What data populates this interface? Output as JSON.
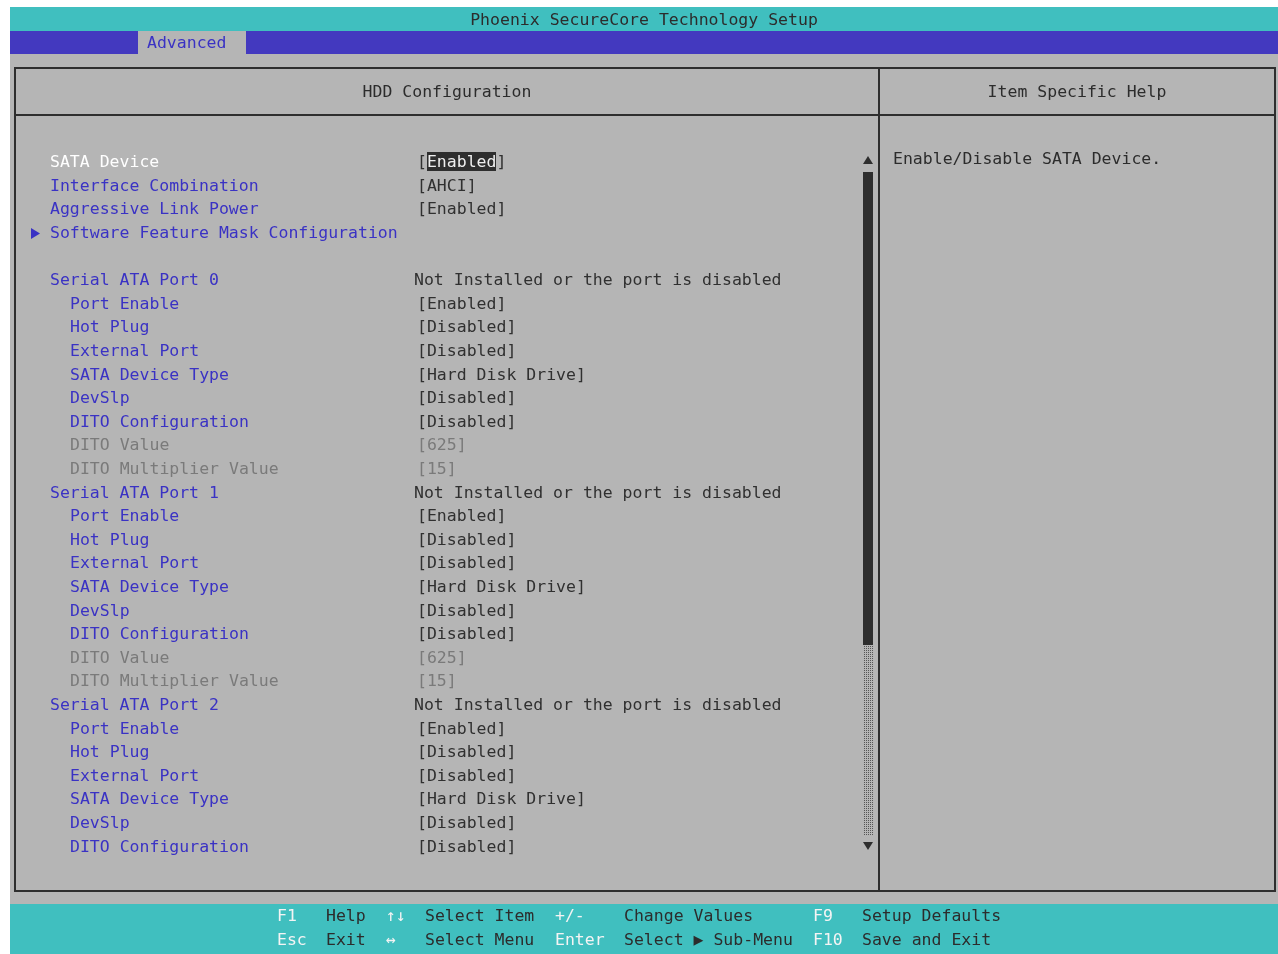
{
  "window": {
    "title": "Phoenix SecureCore Technology Setup"
  },
  "tabs": [
    {
      "label": "Advanced",
      "selected": true
    }
  ],
  "panel": {
    "title": "HDD Configuration"
  },
  "help": {
    "title": "Item Specific Help",
    "text": "Enable/Disable SATA Device."
  },
  "sections": [
    {
      "items": [
        {
          "label": "SATA Device",
          "value": "[Enabled]",
          "kind": "option",
          "selected": true,
          "disabled": false
        },
        {
          "label": "Interface Combination",
          "value": "[AHCI]",
          "kind": "option",
          "selected": false,
          "disabled": false
        },
        {
          "label": "Aggressive Link Power",
          "value": "[Enabled]",
          "kind": "option",
          "selected": false,
          "disabled": false
        },
        {
          "label": "Software Feature Mask Configuration",
          "kind": "submenu",
          "selected": false,
          "disabled": false
        }
      ]
    },
    {
      "items": [
        {
          "label": "Serial ATA Port 0",
          "value": "Not Installed or the port is disabled",
          "kind": "info",
          "selected": false,
          "disabled": false,
          "children": [
            {
              "label": "Port Enable",
              "value": "[Enabled]",
              "kind": "option",
              "selected": false,
              "disabled": false
            },
            {
              "label": "Hot Plug",
              "value": "[Disabled]",
              "kind": "option",
              "selected": false,
              "disabled": false
            },
            {
              "label": "External Port",
              "value": "[Disabled]",
              "kind": "option",
              "selected": false,
              "disabled": false
            },
            {
              "label": "SATA Device Type",
              "value": "[Hard Disk Drive]",
              "kind": "option",
              "selected": false,
              "disabled": false
            },
            {
              "label": "DevSlp",
              "value": "[Disabled]",
              "kind": "option",
              "selected": false,
              "disabled": false
            },
            {
              "label": "DITO Configuration",
              "value": "[Disabled]",
              "kind": "option",
              "selected": false,
              "disabled": false
            },
            {
              "label": "DITO Value",
              "value": "[625]",
              "kind": "option",
              "selected": false,
              "disabled": true
            },
            {
              "label": "DITO Multiplier Value",
              "value": "[15]",
              "kind": "option",
              "selected": false,
              "disabled": true
            }
          ]
        },
        {
          "label": "Serial ATA Port 1",
          "value": "Not Installed or the port is disabled",
          "kind": "info",
          "selected": false,
          "disabled": false,
          "children": [
            {
              "label": "Port Enable",
              "value": "[Enabled]",
              "kind": "option",
              "selected": false,
              "disabled": false
            },
            {
              "label": "Hot Plug",
              "value": "[Disabled]",
              "kind": "option",
              "selected": false,
              "disabled": false
            },
            {
              "label": "External Port",
              "value": "[Disabled]",
              "kind": "option",
              "selected": false,
              "disabled": false
            },
            {
              "label": "SATA Device Type",
              "value": "[Hard Disk Drive]",
              "kind": "option",
              "selected": false,
              "disabled": false
            },
            {
              "label": "DevSlp",
              "value": "[Disabled]",
              "kind": "option",
              "selected": false,
              "disabled": false
            },
            {
              "label": "DITO Configuration",
              "value": "[Disabled]",
              "kind": "option",
              "selected": false,
              "disabled": false
            },
            {
              "label": "DITO Value",
              "value": "[625]",
              "kind": "option",
              "selected": false,
              "disabled": true
            },
            {
              "label": "DITO Multiplier Value",
              "value": "[15]",
              "kind": "option",
              "selected": false,
              "disabled": true
            }
          ]
        },
        {
          "label": "Serial ATA Port 2",
          "value": "Not Installed or the port is disabled",
          "kind": "info",
          "selected": false,
          "disabled": false,
          "children": [
            {
              "label": "Port Enable",
              "value": "[Enabled]",
              "kind": "option",
              "selected": false,
              "disabled": false
            },
            {
              "label": "Hot Plug",
              "value": "[Disabled]",
              "kind": "option",
              "selected": false,
              "disabled": false
            },
            {
              "label": "External Port",
              "value": "[Disabled]",
              "kind": "option",
              "selected": false,
              "disabled": false
            },
            {
              "label": "SATA Device Type",
              "value": "[Hard Disk Drive]",
              "kind": "option",
              "selected": false,
              "disabled": false
            },
            {
              "label": "DevSlp",
              "value": "[Disabled]",
              "kind": "option",
              "selected": false,
              "disabled": false
            },
            {
              "label": "DITO Configuration",
              "value": "[Disabled]",
              "kind": "option",
              "selected": false,
              "disabled": false
            }
          ]
        }
      ]
    }
  ],
  "footer": [
    {
      "key": "F1",
      "action": "Help"
    },
    {
      "key": "↑↓",
      "action": "Select Item"
    },
    {
      "key": "+/-",
      "action": "Change Values"
    },
    {
      "key": "F9",
      "action": "Setup Defaults"
    },
    {
      "key": "Esc",
      "action": "Exit"
    },
    {
      "key": "↔",
      "action": "Select Menu"
    },
    {
      "key": "Enter",
      "action": "Select ▶ Sub-Menu"
    },
    {
      "key": "F10",
      "action": "Save and Exit"
    }
  ]
}
